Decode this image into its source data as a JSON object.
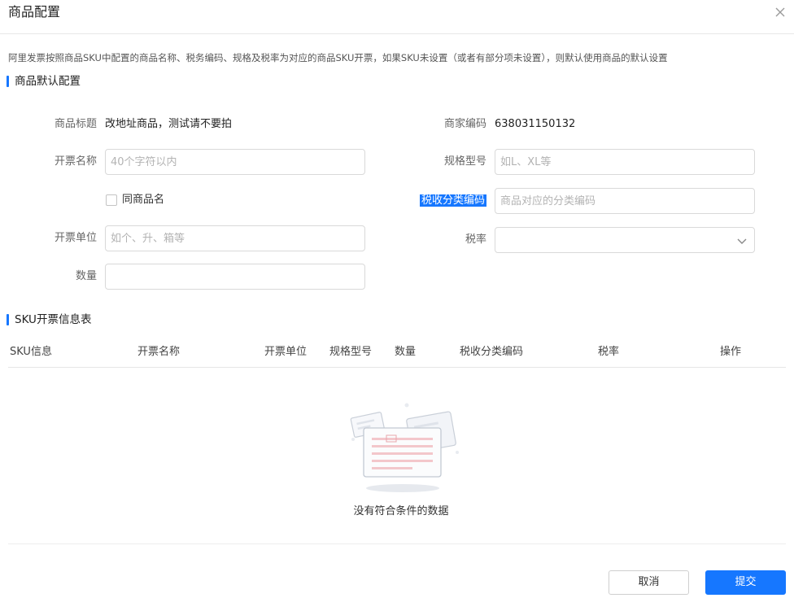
{
  "dialog": {
    "title": "商品配置"
  },
  "notice": "阿里发票按照商品SKU中配置的商品名称、税务编码、规格及税率为对应的商品SKU开票，如果SKU未设置（或者有部分项未设置），则默认使用商品的默认设置",
  "default_section": {
    "title": "商品默认配置",
    "product_title": {
      "label": "商品标题",
      "value": "改地址商品，测试请不要拍"
    },
    "merchant_code": {
      "label": "商家编码",
      "value": "638031150132"
    },
    "invoice_name": {
      "label": "开票名称",
      "placeholder": "40个字符以内",
      "value": ""
    },
    "spec_model": {
      "label": "规格型号",
      "placeholder": "如L、XL等",
      "value": ""
    },
    "same_as_product": {
      "label": "同商品名",
      "checked": false
    },
    "tax_code": {
      "label": "税收分类编码",
      "placeholder": "商品对应的分类编码",
      "value": ""
    },
    "unit": {
      "label": "开票单位",
      "placeholder": "如个、升、箱等",
      "value": ""
    },
    "tax_rate": {
      "label": "税率",
      "selected": ""
    },
    "quantity": {
      "label": "数量",
      "value": ""
    }
  },
  "sku_section": {
    "title": "SKU开票信息表",
    "columns": [
      "SKU信息",
      "开票名称",
      "开票单位",
      "规格型号",
      "数量",
      "税收分类编码",
      "税率",
      "操作"
    ],
    "empty_text": "没有符合条件的数据"
  },
  "footer": {
    "cancel_label": "取消",
    "submit_label": "提交"
  },
  "colors": {
    "primary": "#1677ff",
    "border": "#d9d9d9",
    "placeholder": "#b3b3b3"
  }
}
